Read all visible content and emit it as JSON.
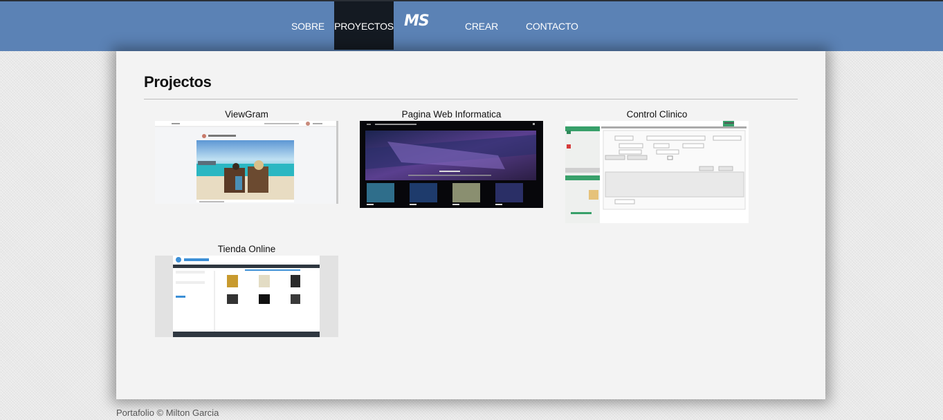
{
  "nav": {
    "items": [
      {
        "label": "SOBRE MI",
        "active": false
      },
      {
        "label": "PROYECTOS",
        "active": true
      },
      {
        "label": "CREAR PROYECTO",
        "active": false
      },
      {
        "label": "CONTACTO",
        "active": false
      }
    ],
    "logo": "MS",
    "bar_color": "#5b82b5",
    "active_color": "#141a22"
  },
  "main": {
    "title": "Projectos",
    "projects": [
      {
        "title": "ViewGram"
      },
      {
        "title": "Pagina Web Informatica"
      },
      {
        "title": "Control Clinico"
      },
      {
        "title": "Tienda Online"
      }
    ]
  },
  "footer": {
    "text": "Portafolio © Milton Garcia"
  }
}
